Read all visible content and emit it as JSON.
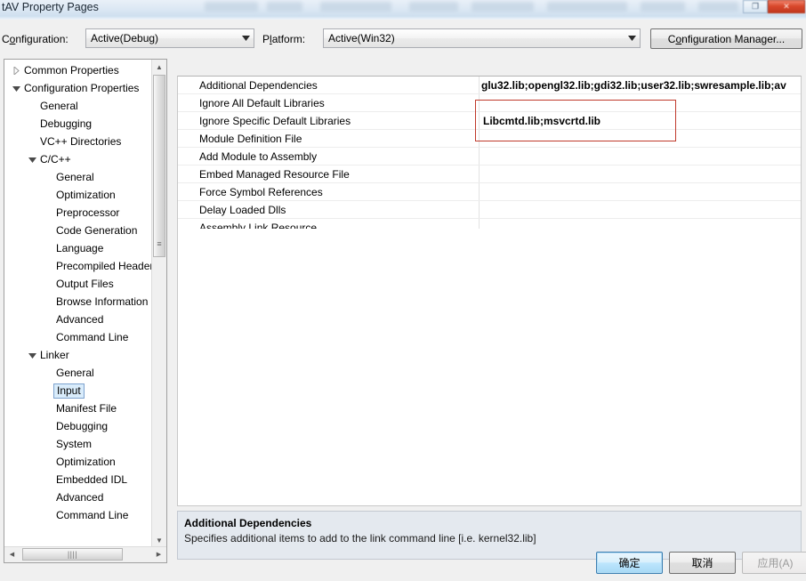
{
  "window": {
    "title": "tAV Property Pages",
    "restore_glyph": "❐",
    "close_glyph": "✕"
  },
  "toolbar": {
    "configuration_label_pre": "C",
    "configuration_label_accel": "o",
    "configuration_label_post": "nfiguration:",
    "configuration_value": "Active(Debug)",
    "platform_label_pre": "P",
    "platform_label_accel": "l",
    "platform_label_post": "atform:",
    "platform_value": "Active(Win32)",
    "config_manager_pre": "C",
    "config_manager_accel": "o",
    "config_manager_post": "nfiguration Manager..."
  },
  "tree": {
    "items": [
      {
        "label": "Common Properties",
        "indent": 0,
        "arrow": "collapsed",
        "selected": false
      },
      {
        "label": "Configuration Properties",
        "indent": 0,
        "arrow": "expanded",
        "selected": false
      },
      {
        "label": "General",
        "indent": 1,
        "arrow": "none",
        "selected": false
      },
      {
        "label": "Debugging",
        "indent": 1,
        "arrow": "none",
        "selected": false
      },
      {
        "label": "VC++ Directories",
        "indent": 1,
        "arrow": "none",
        "selected": false
      },
      {
        "label": "C/C++",
        "indent": 1,
        "arrow": "expanded",
        "selected": false
      },
      {
        "label": "General",
        "indent": 2,
        "arrow": "none",
        "selected": false
      },
      {
        "label": "Optimization",
        "indent": 2,
        "arrow": "none",
        "selected": false
      },
      {
        "label": "Preprocessor",
        "indent": 2,
        "arrow": "none",
        "selected": false
      },
      {
        "label": "Code Generation",
        "indent": 2,
        "arrow": "none",
        "selected": false
      },
      {
        "label": "Language",
        "indent": 2,
        "arrow": "none",
        "selected": false
      },
      {
        "label": "Precompiled Headers",
        "indent": 2,
        "arrow": "none",
        "selected": false
      },
      {
        "label": "Output Files",
        "indent": 2,
        "arrow": "none",
        "selected": false
      },
      {
        "label": "Browse Information",
        "indent": 2,
        "arrow": "none",
        "selected": false
      },
      {
        "label": "Advanced",
        "indent": 2,
        "arrow": "none",
        "selected": false
      },
      {
        "label": "Command Line",
        "indent": 2,
        "arrow": "none",
        "selected": false
      },
      {
        "label": "Linker",
        "indent": 1,
        "arrow": "expanded",
        "selected": false
      },
      {
        "label": "General",
        "indent": 2,
        "arrow": "none",
        "selected": false
      },
      {
        "label": "Input",
        "indent": 2,
        "arrow": "none",
        "selected": true
      },
      {
        "label": "Manifest File",
        "indent": 2,
        "arrow": "none",
        "selected": false
      },
      {
        "label": "Debugging",
        "indent": 2,
        "arrow": "none",
        "selected": false
      },
      {
        "label": "System",
        "indent": 2,
        "arrow": "none",
        "selected": false
      },
      {
        "label": "Optimization",
        "indent": 2,
        "arrow": "none",
        "selected": false
      },
      {
        "label": "Embedded IDL",
        "indent": 2,
        "arrow": "none",
        "selected": false
      },
      {
        "label": "Advanced",
        "indent": 2,
        "arrow": "none",
        "selected": false
      },
      {
        "label": "Command Line",
        "indent": 2,
        "arrow": "none",
        "selected": false
      }
    ],
    "scroll_grip": "≡",
    "hscroll_grip": "||||",
    "arrow_up": "▲",
    "arrow_down": "▼",
    "arrow_left": "◀",
    "arrow_right": "▶"
  },
  "grid": {
    "rows": [
      {
        "name": "Additional Dependencies",
        "value": "glu32.lib;opengl32.lib;gdi32.lib;user32.lib;swresample.lib;av"
      },
      {
        "name": "Ignore All Default Libraries",
        "value": ""
      },
      {
        "name": "Ignore Specific Default Libraries",
        "value": ""
      },
      {
        "name": "Module Definition File",
        "value": ""
      },
      {
        "name": "Add Module to Assembly",
        "value": ""
      },
      {
        "name": "Embed Managed Resource File",
        "value": ""
      },
      {
        "name": "Force Symbol References",
        "value": ""
      },
      {
        "name": "Delay Loaded Dlls",
        "value": ""
      },
      {
        "name": "Assembly Link Resource",
        "value": ""
      }
    ]
  },
  "annotation": {
    "text": "Libcmtd.lib;msvcrtd.lib",
    "border_color": "#c0392b"
  },
  "description": {
    "title": "Additional Dependencies",
    "body": "Specifies additional items to add to the link command line [i.e. kernel32.lib]"
  },
  "footer": {
    "ok_label": "确定",
    "cancel_label": "取消",
    "apply_label": "应用(A)"
  }
}
